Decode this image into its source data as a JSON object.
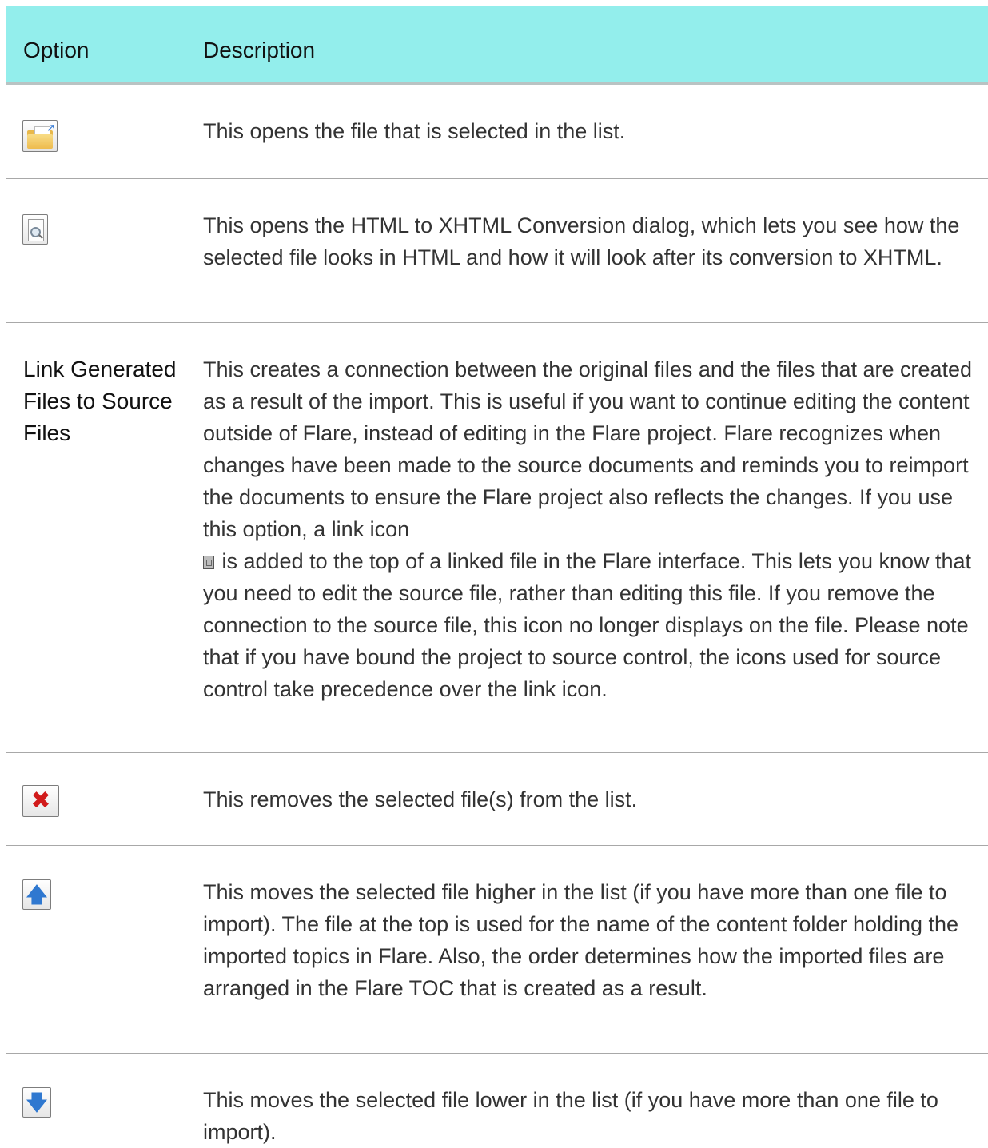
{
  "table": {
    "header": {
      "option": "Option",
      "description": "Description"
    },
    "rows": [
      {
        "option_icon": "open-file-icon",
        "description": "This opens the file that is selected in the list."
      },
      {
        "option_icon": "preview-icon",
        "description": "This opens the HTML to XHTML Conversion dialog, which lets you see how the selected file looks in HTML and how it will look after its conversion to XHTML."
      },
      {
        "option_text": "Link Generated Files to Source Files",
        "description_before_icon": "This creates a connection between the original files and the files that are created as a result of the import. This is useful if you want to continue editing the content outside of Flare, instead of editing in the Flare project. Flare recognizes when changes have been made to the source documents and reminds you to reimport the documents to ensure the Flare project also reflects the changes. If you use this option, a link icon",
        "inline_icon": "link-icon",
        "description_after_icon": " is added to the top of a linked file in the Flare interface. This lets you know that you need to edit the source file, rather than editing this file. If you remove the connection to the source file, this icon no longer displays on the file. Please note that if you have bound the project to source control, the icons used for source control take precedence over the link icon."
      },
      {
        "option_icon": "remove-icon",
        "description": "This removes the selected file(s) from the list."
      },
      {
        "option_icon": "move-up-icon",
        "description": "This moves the selected file higher in the list (if you have more than one file to import). The file at the top is used for the name of the content folder holding the imported topics in Flare. Also, the order determines how the imported files are arranged in the Flare TOC that is created as a result."
      },
      {
        "option_icon": "move-down-icon",
        "description": "This moves the selected file lower in the list (if you have more than one file to import)."
      }
    ]
  },
  "colors": {
    "header_bg": "#93eeec",
    "remove_icon": "#d11a1a",
    "arrow_icon": "#2f78d0"
  }
}
